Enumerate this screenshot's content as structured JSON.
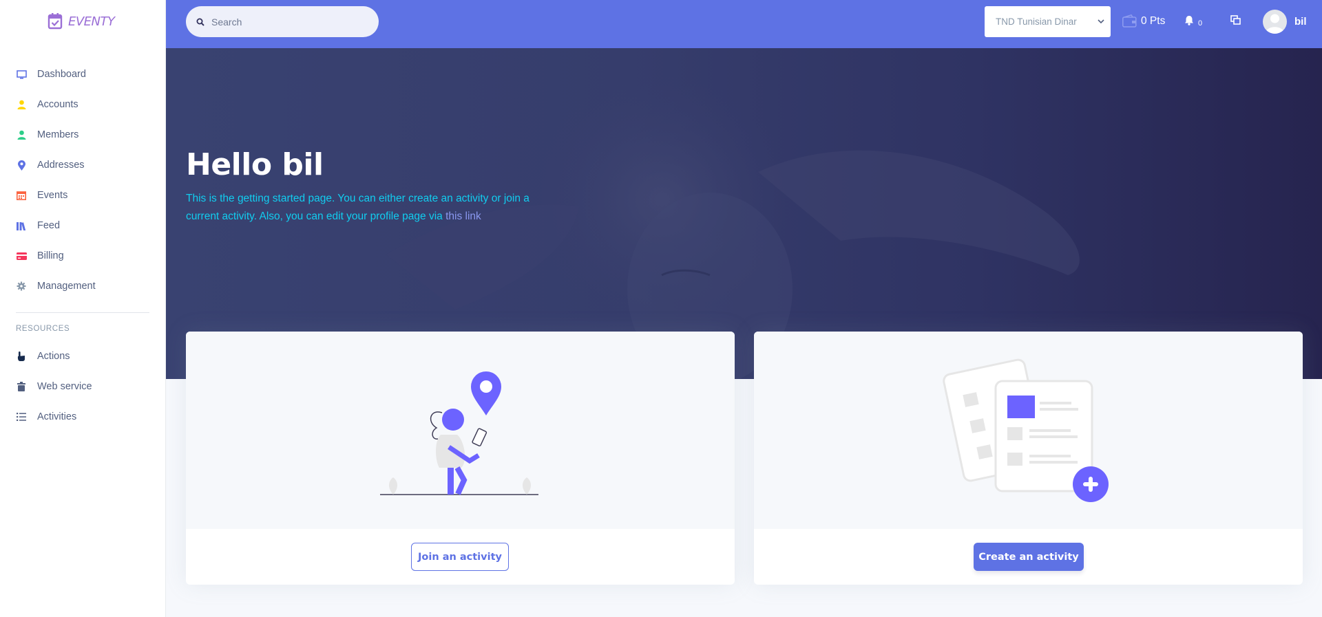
{
  "brand": {
    "name": "EVENTY",
    "color": "#9b6fd6"
  },
  "sidebar": {
    "items": [
      {
        "label": "Dashboard",
        "icon": "monitor-icon",
        "color": "#5e72e4"
      },
      {
        "label": "Accounts",
        "icon": "user-icon",
        "color": "#ffd600"
      },
      {
        "label": "Members",
        "icon": "user-icon",
        "color": "#2dce89"
      },
      {
        "label": "Addresses",
        "icon": "map-pin-icon",
        "color": "#5e72e4"
      },
      {
        "label": "Events",
        "icon": "calendar-icon",
        "color": "#fb6340"
      },
      {
        "label": "Feed",
        "icon": "books-icon",
        "color": "#5e72e4"
      },
      {
        "label": "Billing",
        "icon": "credit-card-icon",
        "color": "#f5365c"
      },
      {
        "label": "Management",
        "icon": "gear-icon",
        "color": "#8898aa"
      }
    ],
    "resources_title": "RESOURCES",
    "resources": [
      {
        "label": "Actions",
        "icon": "hand-pointer-icon",
        "color": "#172b4d"
      },
      {
        "label": "Web service",
        "icon": "trash-icon",
        "color": "#525f7f"
      },
      {
        "label": "Activities",
        "icon": "list-icon",
        "color": "#525f7f"
      }
    ]
  },
  "topbar": {
    "search_placeholder": "Search",
    "currency": "TND Tunisian Dinar",
    "points": "0 Pts",
    "notifications": "0",
    "username": "bil",
    "accent": "#5e72e4"
  },
  "hero": {
    "title": "Hello bil",
    "text": "This is the getting started page. You can either create an activity or join a current activity. Also, you can edit your profile page via ",
    "link": "this link"
  },
  "cards": {
    "join_label": "Join an activity",
    "create_label": "Create an activity"
  }
}
